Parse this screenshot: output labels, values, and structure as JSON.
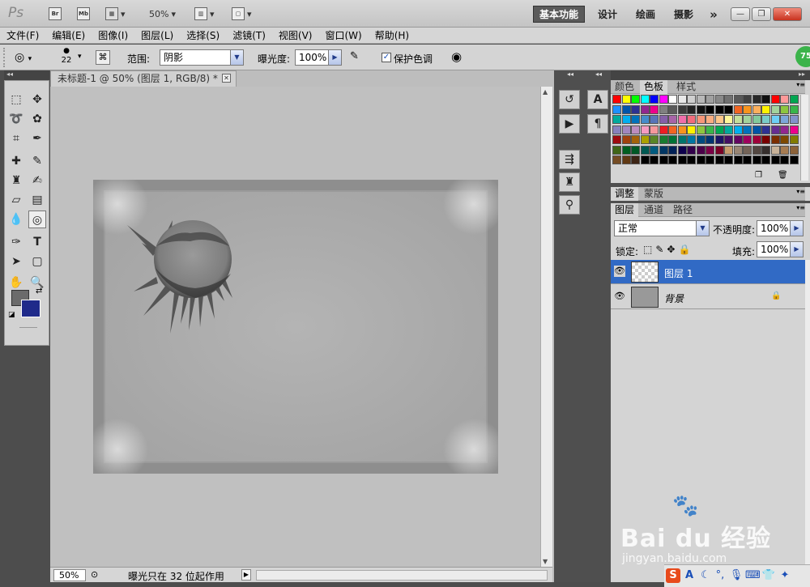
{
  "app": {
    "logo": "Ps",
    "bridge": "Br",
    "minibridge": "Mb",
    "zoom": "50%",
    "workspaces": [
      "基本功能",
      "设计",
      "绘画",
      "摄影"
    ],
    "more": "»"
  },
  "menu": [
    "文件(F)",
    "编辑(E)",
    "图像(I)",
    "图层(L)",
    "选择(S)",
    "滤镜(T)",
    "视图(V)",
    "窗口(W)",
    "帮助(H)"
  ],
  "options": {
    "brush_size": "22",
    "range_label": "范围:",
    "range_value": "阴影",
    "exposure_label": "曝光度:",
    "exposure_value": "100%",
    "protect_tones": "保护色调",
    "badge": "75"
  },
  "document": {
    "tab_title": "未标题-1 @ 50% (图层 1, RGB/8) *",
    "zoom": "50%",
    "status": "曝光只在 32 位起作用"
  },
  "panels": {
    "color_tabs": [
      "颜色",
      "色板",
      "样式"
    ],
    "adjust_tabs": [
      "调整",
      "蒙版"
    ],
    "layer_tabs": [
      "图层",
      "通道",
      "路径"
    ],
    "blend_mode": "正常",
    "opacity_label": "不透明度:",
    "opacity_value": "100%",
    "lock_label": "锁定:",
    "fill_label": "填充:",
    "fill_value": "100%",
    "layers": [
      {
        "name": "图层 1",
        "selected": true
      },
      {
        "name": "背景",
        "selected": false
      }
    ]
  },
  "swatches": [
    [
      "#ff0000",
      "#ffff00",
      "#00ff00",
      "#00ffff",
      "#0000ff",
      "#ff00ff",
      "#ffffff",
      "#e8e8e8",
      "#d0d0d0",
      "#b8b8b8",
      "#a0a0a0",
      "#888888",
      "#707070",
      "#585858",
      "#404040",
      "#282828",
      "#101010",
      "#ff0000",
      "#ff9999",
      "#00a651"
    ],
    [
      "#1e90ff",
      "#0055aa",
      "#2e3192",
      "#92278f",
      "#ec008c",
      "#808080",
      "#5a5a5a",
      "#3a3a3a",
      "#222222",
      "#111111",
      "#000000",
      "#000000",
      "#000000",
      "#f26522",
      "#f7941d",
      "#fbaf5d",
      "#fff200",
      "#a3d39c",
      "#8dc63f",
      "#39b54a"
    ],
    [
      "#00a99d",
      "#00aeef",
      "#0072bc",
      "#448ccb",
      "#5674b9",
      "#8560a8",
      "#a864a8",
      "#f06eaa",
      "#f26d7d",
      "#f69679",
      "#f9ad81",
      "#fdc68a",
      "#fff79a",
      "#c4df9b",
      "#a2d39c",
      "#82ca9c",
      "#7accc8",
      "#6dcff6",
      "#7da7d9",
      "#8393ca"
    ],
    [
      "#8781bd",
      "#a187be",
      "#bc8dbf",
      "#f49ac1",
      "#f5989d",
      "#ed1c24",
      "#f26522",
      "#f7941d",
      "#fff200",
      "#8dc63f",
      "#39b54a",
      "#00a651",
      "#00a99d",
      "#00aeef",
      "#0072bc",
      "#0054a6",
      "#2e3192",
      "#662d91",
      "#92278f",
      "#ec008c"
    ],
    [
      "#9e0b0f",
      "#a0410d",
      "#a3620a",
      "#aba000",
      "#598527",
      "#197b30",
      "#007236",
      "#00746b",
      "#0076a3",
      "#004b80",
      "#003471",
      "#1b1464",
      "#440e62",
      "#630460",
      "#9e005d",
      "#9e0039",
      "#790000",
      "#7b2e00",
      "#7d4900",
      "#827b00"
    ],
    [
      "#406618",
      "#005e20",
      "#005826",
      "#005952",
      "#005b7f",
      "#003663",
      "#002157",
      "#0d004c",
      "#32004b",
      "#4b0049",
      "#7b0046",
      "#7a0026",
      "#c69c6d",
      "#998675",
      "#736357",
      "#534741",
      "#362f2d",
      "#c7b299",
      "#a67c52",
      "#8c6239"
    ],
    [
      "#754c24",
      "#603913",
      "#3c2415",
      "#000000",
      "#000000",
      "#000000",
      "#000000",
      "#000000",
      "#000000",
      "#000000",
      "#000000",
      "#000000",
      "#000000",
      "#000000",
      "#000000",
      "#000000",
      "#000000",
      "#000000",
      "#000000",
      "#000000"
    ]
  ],
  "colors": {
    "foreground": "#6b6b6b",
    "background": "#1f2a8a",
    "selection": "#316ac5"
  },
  "watermark": {
    "brand": "Bai du 经验",
    "url": "jingyan.baidu.com"
  }
}
